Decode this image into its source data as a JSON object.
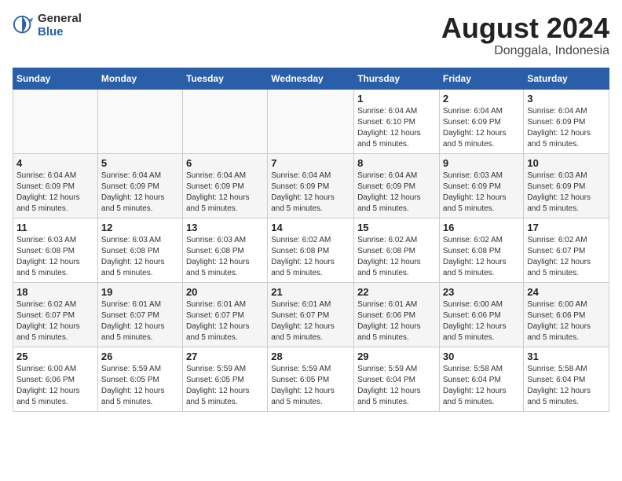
{
  "logo": {
    "general": "General",
    "blue": "Blue"
  },
  "title": "August 2024",
  "location": "Donggala, Indonesia",
  "weekdays": [
    "Sunday",
    "Monday",
    "Tuesday",
    "Wednesday",
    "Thursday",
    "Friday",
    "Saturday"
  ],
  "weeks": [
    [
      {
        "day": "",
        "info": ""
      },
      {
        "day": "",
        "info": ""
      },
      {
        "day": "",
        "info": ""
      },
      {
        "day": "",
        "info": ""
      },
      {
        "day": "1",
        "info": "Sunrise: 6:04 AM\nSunset: 6:10 PM\nDaylight: 12 hours\nand 5 minutes."
      },
      {
        "day": "2",
        "info": "Sunrise: 6:04 AM\nSunset: 6:09 PM\nDaylight: 12 hours\nand 5 minutes."
      },
      {
        "day": "3",
        "info": "Sunrise: 6:04 AM\nSunset: 6:09 PM\nDaylight: 12 hours\nand 5 minutes."
      }
    ],
    [
      {
        "day": "4",
        "info": "Sunrise: 6:04 AM\nSunset: 6:09 PM\nDaylight: 12 hours\nand 5 minutes."
      },
      {
        "day": "5",
        "info": "Sunrise: 6:04 AM\nSunset: 6:09 PM\nDaylight: 12 hours\nand 5 minutes."
      },
      {
        "day": "6",
        "info": "Sunrise: 6:04 AM\nSunset: 6:09 PM\nDaylight: 12 hours\nand 5 minutes."
      },
      {
        "day": "7",
        "info": "Sunrise: 6:04 AM\nSunset: 6:09 PM\nDaylight: 12 hours\nand 5 minutes."
      },
      {
        "day": "8",
        "info": "Sunrise: 6:04 AM\nSunset: 6:09 PM\nDaylight: 12 hours\nand 5 minutes."
      },
      {
        "day": "9",
        "info": "Sunrise: 6:03 AM\nSunset: 6:09 PM\nDaylight: 12 hours\nand 5 minutes."
      },
      {
        "day": "10",
        "info": "Sunrise: 6:03 AM\nSunset: 6:09 PM\nDaylight: 12 hours\nand 5 minutes."
      }
    ],
    [
      {
        "day": "11",
        "info": "Sunrise: 6:03 AM\nSunset: 6:08 PM\nDaylight: 12 hours\nand 5 minutes."
      },
      {
        "day": "12",
        "info": "Sunrise: 6:03 AM\nSunset: 6:08 PM\nDaylight: 12 hours\nand 5 minutes."
      },
      {
        "day": "13",
        "info": "Sunrise: 6:03 AM\nSunset: 6:08 PM\nDaylight: 12 hours\nand 5 minutes."
      },
      {
        "day": "14",
        "info": "Sunrise: 6:02 AM\nSunset: 6:08 PM\nDaylight: 12 hours\nand 5 minutes."
      },
      {
        "day": "15",
        "info": "Sunrise: 6:02 AM\nSunset: 6:08 PM\nDaylight: 12 hours\nand 5 minutes."
      },
      {
        "day": "16",
        "info": "Sunrise: 6:02 AM\nSunset: 6:08 PM\nDaylight: 12 hours\nand 5 minutes."
      },
      {
        "day": "17",
        "info": "Sunrise: 6:02 AM\nSunset: 6:07 PM\nDaylight: 12 hours\nand 5 minutes."
      }
    ],
    [
      {
        "day": "18",
        "info": "Sunrise: 6:02 AM\nSunset: 6:07 PM\nDaylight: 12 hours\nand 5 minutes."
      },
      {
        "day": "19",
        "info": "Sunrise: 6:01 AM\nSunset: 6:07 PM\nDaylight: 12 hours\nand 5 minutes."
      },
      {
        "day": "20",
        "info": "Sunrise: 6:01 AM\nSunset: 6:07 PM\nDaylight: 12 hours\nand 5 minutes."
      },
      {
        "day": "21",
        "info": "Sunrise: 6:01 AM\nSunset: 6:07 PM\nDaylight: 12 hours\nand 5 minutes."
      },
      {
        "day": "22",
        "info": "Sunrise: 6:01 AM\nSunset: 6:06 PM\nDaylight: 12 hours\nand 5 minutes."
      },
      {
        "day": "23",
        "info": "Sunrise: 6:00 AM\nSunset: 6:06 PM\nDaylight: 12 hours\nand 5 minutes."
      },
      {
        "day": "24",
        "info": "Sunrise: 6:00 AM\nSunset: 6:06 PM\nDaylight: 12 hours\nand 5 minutes."
      }
    ],
    [
      {
        "day": "25",
        "info": "Sunrise: 6:00 AM\nSunset: 6:06 PM\nDaylight: 12 hours\nand 5 minutes."
      },
      {
        "day": "26",
        "info": "Sunrise: 5:59 AM\nSunset: 6:05 PM\nDaylight: 12 hours\nand 5 minutes."
      },
      {
        "day": "27",
        "info": "Sunrise: 5:59 AM\nSunset: 6:05 PM\nDaylight: 12 hours\nand 5 minutes."
      },
      {
        "day": "28",
        "info": "Sunrise: 5:59 AM\nSunset: 6:05 PM\nDaylight: 12 hours\nand 5 minutes."
      },
      {
        "day": "29",
        "info": "Sunrise: 5:59 AM\nSunset: 6:04 PM\nDaylight: 12 hours\nand 5 minutes."
      },
      {
        "day": "30",
        "info": "Sunrise: 5:58 AM\nSunset: 6:04 PM\nDaylight: 12 hours\nand 5 minutes."
      },
      {
        "day": "31",
        "info": "Sunrise: 5:58 AM\nSunset: 6:04 PM\nDaylight: 12 hours\nand 5 minutes."
      }
    ]
  ]
}
